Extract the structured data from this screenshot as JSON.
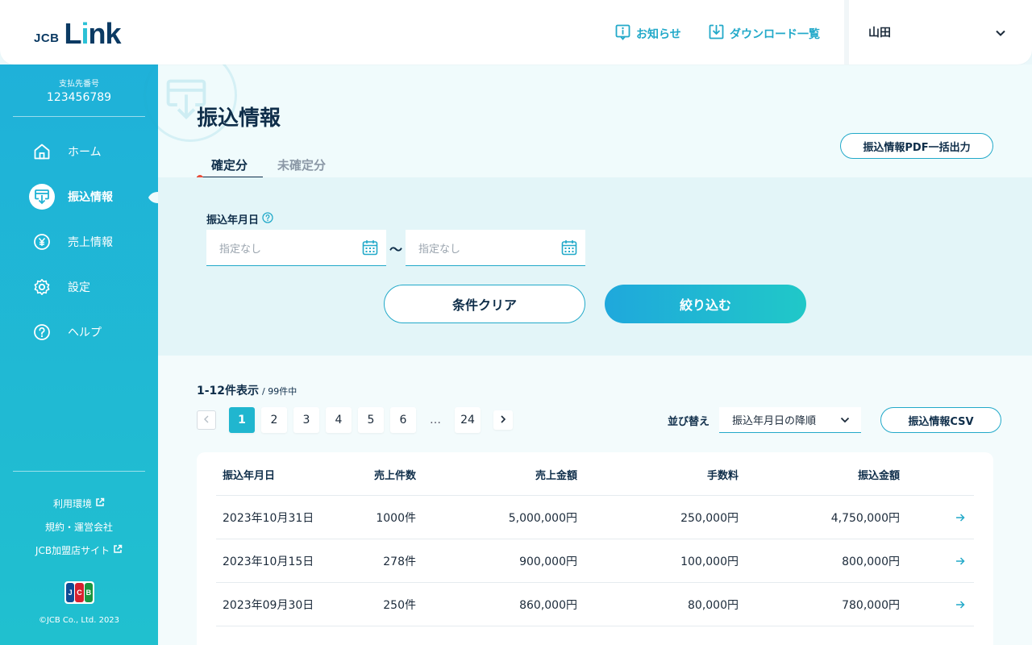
{
  "header": {
    "logo_prefix": "JCB",
    "logo_word_a": "L",
    "logo_word_dot": "i",
    "logo_word_b": "nk",
    "news_label": "お知らせ",
    "download_label": "ダウンロード一覧",
    "user_name": "山田"
  },
  "sidebar": {
    "payee_label": "支払先番号",
    "payee_number": "123456789",
    "nav": [
      {
        "label": "ホーム",
        "icon": "home-icon"
      },
      {
        "label": "振込情報",
        "icon": "transfer-icon",
        "active": true
      },
      {
        "label": "売上情報",
        "icon": "yen-icon"
      },
      {
        "label": "設定",
        "icon": "gear-icon"
      },
      {
        "label": "ヘルプ",
        "icon": "help-icon"
      }
    ],
    "footer_links": [
      "利用環境",
      "規約・運営会社",
      "JCB加盟店サイト"
    ],
    "badge_letters": [
      "J",
      "C",
      "B"
    ],
    "copyright": "©JCB Co., Ltd. 2023"
  },
  "page": {
    "title": "振込情報",
    "tabs": [
      "確定分",
      "未確定分"
    ],
    "pdf_button": "振込情報PDF一括出力"
  },
  "filter": {
    "date_label": "振込年月日",
    "from_placeholder": "指定なし",
    "to_placeholder": "指定なし",
    "separator": "〜",
    "clear_button": "条件クリア",
    "search_button": "絞り込む"
  },
  "list": {
    "range": "1-12件表示",
    "total": "/ 99件中",
    "pages": [
      "1",
      "2",
      "3",
      "4",
      "5",
      "6",
      "…",
      "24"
    ],
    "sort_label": "並び替え",
    "sort_value": "振込年月日の降順",
    "csv_button": "振込情報CSV"
  },
  "table": {
    "headers": [
      "振込年月日",
      "売上件数",
      "売上金額",
      "手数料",
      "振込金額"
    ],
    "rows": [
      [
        "2023年10月31日",
        "1000件",
        "5,000,000円",
        "250,000円",
        "4,750,000円"
      ],
      [
        "2023年10月15日",
        "278件",
        "900,000円",
        "100,000円",
        "800,000円"
      ],
      [
        "2023年09月30日",
        "250件",
        "860,000円",
        "80,000円",
        "780,000円"
      ]
    ]
  },
  "colors": {
    "accent": "#22a9c9",
    "navy": "#0f2e4a",
    "alert_dot": "#ec4d3a"
  }
}
